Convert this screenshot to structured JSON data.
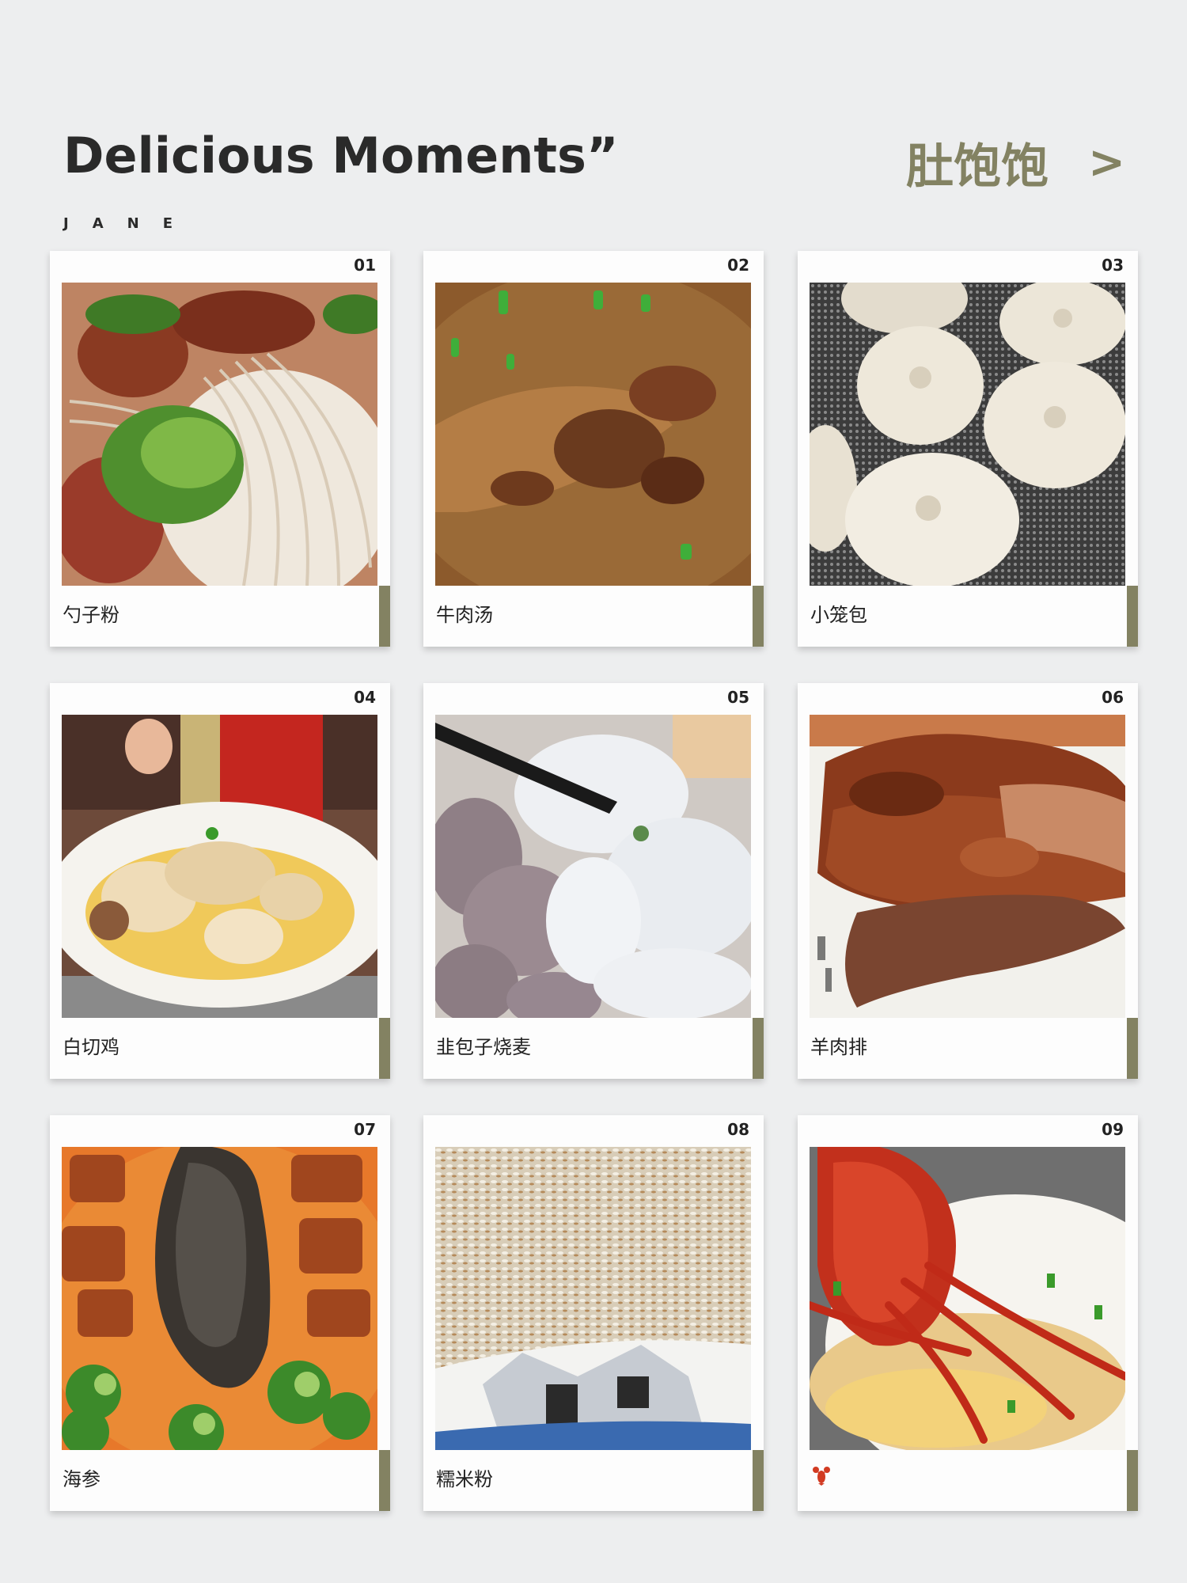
{
  "header": {
    "title": "Delicious Moments”",
    "subtitle": "JANE",
    "brand": "肚饱饱",
    "arrow": ">"
  },
  "colors": {
    "background": "#edeeef",
    "accent": "#838262",
    "card": "#fdfdfd"
  },
  "cards": [
    {
      "number": "01",
      "label": "勺子粉"
    },
    {
      "number": "02",
      "label": "牛肉汤"
    },
    {
      "number": "03",
      "label": "小笼包"
    },
    {
      "number": "04",
      "label": "白切鸡"
    },
    {
      "number": "05",
      "label": "韭包子烧麦"
    },
    {
      "number": "06",
      "label": "羊肉排"
    },
    {
      "number": "07",
      "label": "海参"
    },
    {
      "number": "08",
      "label": "糯米粉"
    },
    {
      "number": "09",
      "label": "",
      "icon": "lobster-icon"
    }
  ]
}
